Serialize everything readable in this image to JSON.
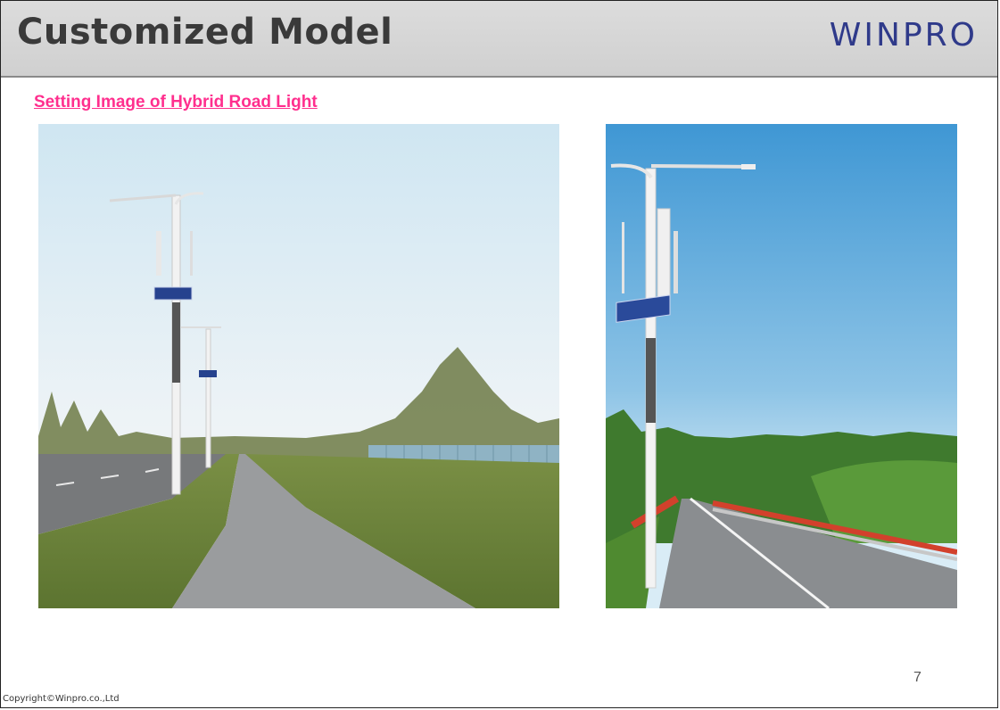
{
  "slide": {
    "title": "Customized Model",
    "brand": "WINPRO",
    "subtitle": "Setting Image of Hybrid Road Light",
    "page_number": "7",
    "copyright": "Copyright©Winpro.co.,Ltd"
  },
  "images": {
    "left": "road-with-hybrid-lights-photo",
    "right": "bridge-road-with-hybrid-light-photo"
  },
  "colors": {
    "header_bg": "#d3d3d3",
    "title": "#3a3a3a",
    "brand": "#2f3a8a",
    "subtitle": "#ff2f8e"
  }
}
